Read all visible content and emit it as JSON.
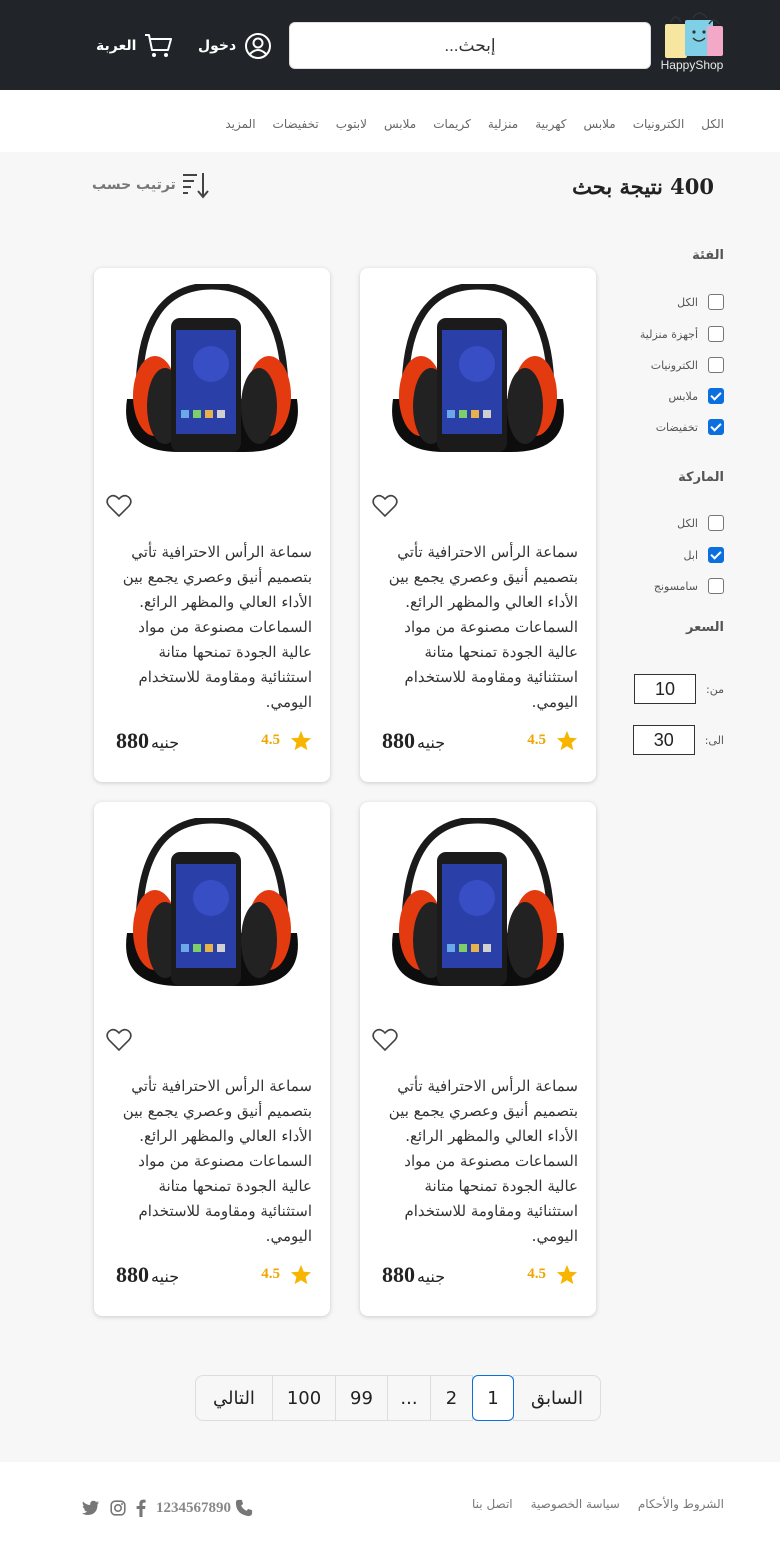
{
  "header": {
    "logo_text": "HappyShop",
    "search_placeholder": "إبحث...",
    "login_label": "دخول",
    "cart_label": "العربة"
  },
  "categories": [
    "الكل",
    "الكترونيات",
    "ملابس",
    "كهربية",
    "منزلية",
    "كريمات",
    "ملابس",
    "لابتوب",
    "تخفيضات",
    "المزيد"
  ],
  "results": {
    "title": "400 نتيجة بحث",
    "sort_label": "ترتيب حسب"
  },
  "filters": {
    "category_title": "الفئة",
    "category_options": [
      {
        "label": "الكل",
        "checked": false
      },
      {
        "label": "أجهزة منزلية",
        "checked": false
      },
      {
        "label": "الكترونيات",
        "checked": false
      },
      {
        "label": "ملابس",
        "checked": true
      },
      {
        "label": "تخفيضات",
        "checked": true
      }
    ],
    "brand_title": "الماركة",
    "brand_options": [
      {
        "label": "الكل",
        "checked": false
      },
      {
        "label": "ابل",
        "checked": true
      },
      {
        "label": "سامسونج",
        "checked": false
      }
    ],
    "price_title": "السعر",
    "price_from_label": "من:",
    "price_from_value": "10",
    "price_to_label": "الى:",
    "price_to_value": "30"
  },
  "products": [
    {
      "description": "سماعة الرأس الاحترافية تأتي بتصميم أنيق وعصري يجمع بين الأداء العالي والمظهر الرائع. السماعات مصنوعة من مواد عالية الجودة تمنحها متانة استثنائية ومقاومة للاستخدام اليومي.",
      "price": "880",
      "currency": "جنيه",
      "rating": "4.5"
    },
    {
      "description": "سماعة الرأس الاحترافية تأتي بتصميم أنيق وعصري يجمع بين الأداء العالي والمظهر الرائع. السماعات مصنوعة من مواد عالية الجودة تمنحها متانة استثنائية ومقاومة للاستخدام اليومي.",
      "price": "880",
      "currency": "جنيه",
      "rating": "4.5"
    },
    {
      "description": "سماعة الرأس الاحترافية تأتي بتصميم أنيق وعصري يجمع بين الأداء العالي والمظهر الرائع. السماعات مصنوعة من مواد عالية الجودة تمنحها متانة استثنائية ومقاومة للاستخدام اليومي.",
      "price": "880",
      "currency": "جنيه",
      "rating": "4.5"
    },
    {
      "description": "سماعة الرأس الاحترافية تأتي بتصميم أنيق وعصري يجمع بين الأداء العالي والمظهر الرائع. السماعات مصنوعة من مواد عالية الجودة تمنحها متانة استثنائية ومقاومة للاستخدام اليومي.",
      "price": "880",
      "currency": "جنيه",
      "rating": "4.5"
    }
  ],
  "pagination": {
    "prev": "السابق",
    "pages": [
      "1",
      "2",
      "...",
      "99",
      "100"
    ],
    "active_page": "1",
    "next": "التالي"
  },
  "footer": {
    "links": [
      "الشروط والأحكام",
      "سياسة الخصوصية",
      "اتصل بنا"
    ],
    "phone": "1234567890"
  },
  "colors": {
    "header_bg": "#212428",
    "accent": "#0b6fe0",
    "star": "#f7b500"
  }
}
